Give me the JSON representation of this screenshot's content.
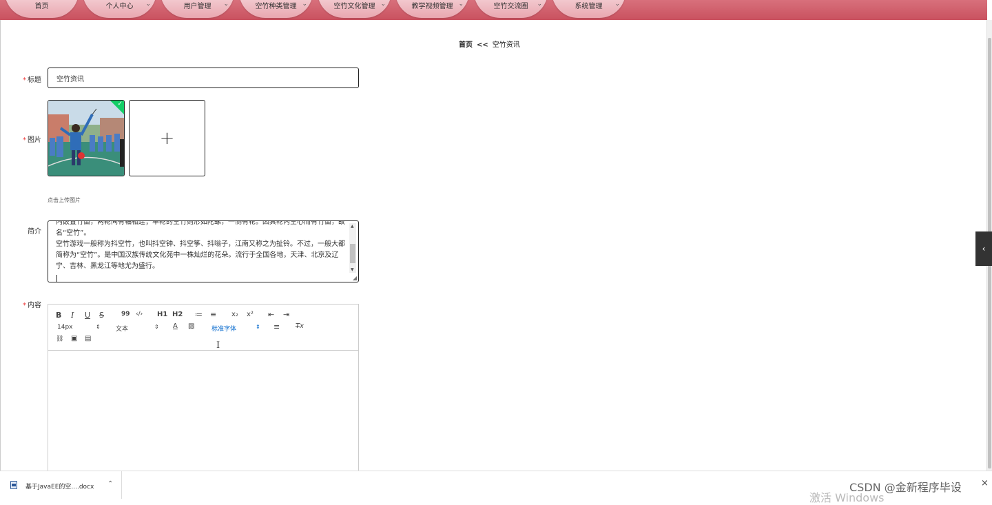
{
  "nav": {
    "items": [
      {
        "label": "首页",
        "has_menu": false
      },
      {
        "label": "个人中心",
        "has_menu": true
      },
      {
        "label": "用户管理",
        "has_menu": true
      },
      {
        "label": "空竹种类管理",
        "has_menu": true
      },
      {
        "label": "空竹文化管理",
        "has_menu": true
      },
      {
        "label": "教学视频管理",
        "has_menu": true
      },
      {
        "label": "空竹交流圈",
        "has_menu": true
      },
      {
        "label": "系统管理",
        "has_menu": true
      }
    ],
    "chevron": "⌄"
  },
  "breadcrumb": {
    "home": "首页",
    "separator": "<<",
    "current": "空竹资讯"
  },
  "form": {
    "required_mark": "*",
    "title_label": "标题",
    "title_value": "空竹资讯",
    "image_label": "图片",
    "upload_plus": "+",
    "upload_tip": "点击上传图片",
    "intro_label": "简介",
    "intro_text": "内嵌置竹笛，两轮间有轴相连；单轮的空竹则形如陀螺，一侧有轮。因其轮内空心而有竹笛，故名“空竹”。\n空竹游戏一般称为抖空竹，也叫抖空钟、抖空筝、抖嗡子，江南又称之为扯铃。不过，一般大都简称为“空竹”。是中国汉族传统文化苑中一株灿烂的花朵。流行于全国各地，天津、北京及辽宁、吉林、黑龙江等地尤为盛行。",
    "content_label": "内容"
  },
  "editor": {
    "bold": "B",
    "italic": "I",
    "underline": "U",
    "strike": "S",
    "quote": "99",
    "code": "‹/›",
    "h1": "H1",
    "h2": "H2",
    "ordered": "≔",
    "bullet": "≡",
    "sub": "x₂",
    "sup": "x²",
    "outdent": "⇤",
    "indent": "⇥",
    "size": "14px",
    "header": "文本",
    "font": "标准字体",
    "align": "≡",
    "clean": "T̶x",
    "link": "🔗",
    "image": "▣",
    "video": "▤"
  },
  "side_toggle": "‹",
  "download": {
    "file_name": "基于JavaEE的空....docx",
    "chevron": "⌃"
  },
  "watermark": "CSDN @金新程序毕设",
  "windows_mark": "激活 Windows",
  "close": "×",
  "colors": {
    "nav_bg": "#c9515f",
    "nav_pill": "#f2c6cc",
    "success": "#13ce66",
    "accent": "#06c"
  }
}
